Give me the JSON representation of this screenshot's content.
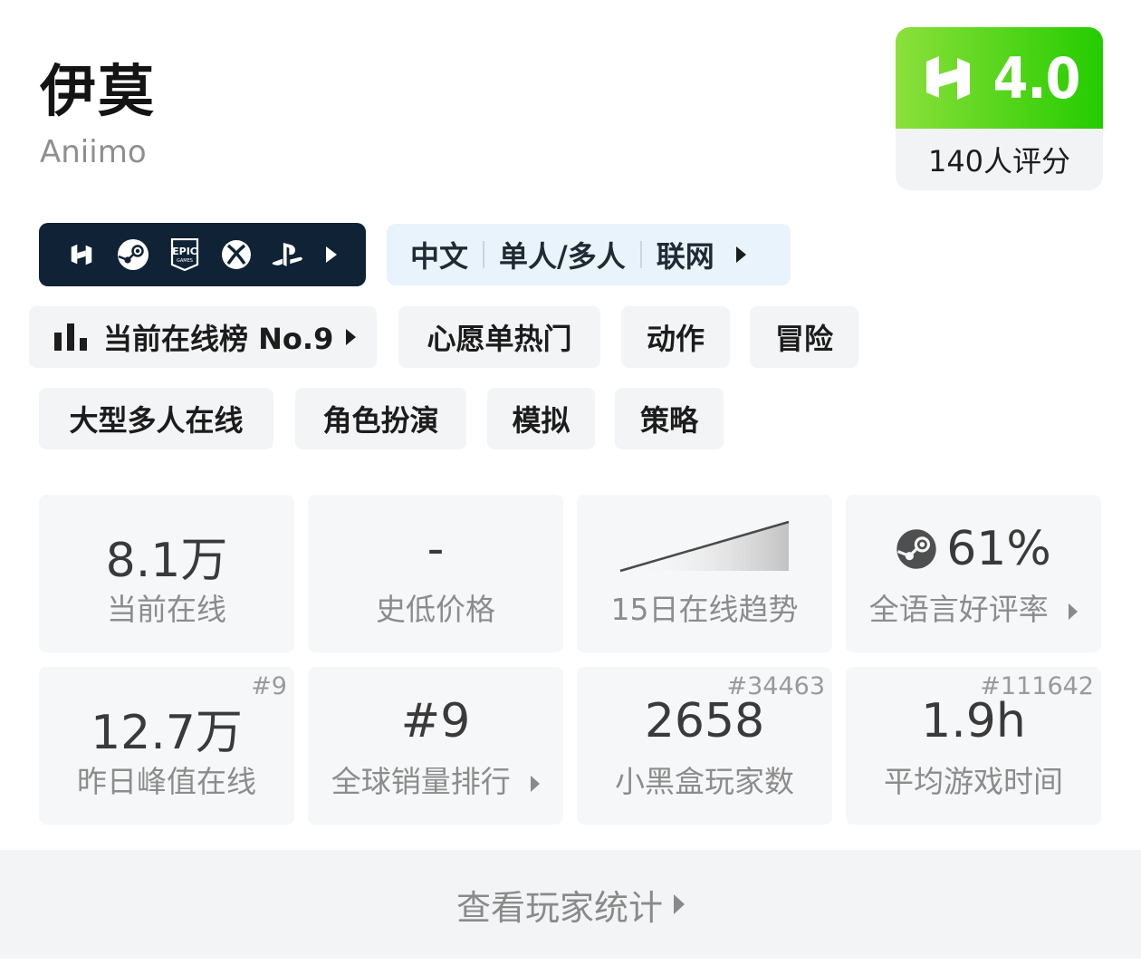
{
  "game": {
    "title": "伊莫",
    "subtitle": "Aniimo"
  },
  "score": {
    "value": "4.0",
    "count_label": "140人评分"
  },
  "platforms": {
    "icons": [
      "heybox-icon",
      "steam-icon",
      "epic-games-icon",
      "xbox-icon",
      "playstation-icon"
    ]
  },
  "features": {
    "items": [
      "中文",
      "单人/多人",
      "联网"
    ]
  },
  "tags": {
    "ranking": "当前在线榜 No.9",
    "wishlist": "心愿单热门",
    "items": [
      "动作",
      "冒险",
      "大型多人在线",
      "角色扮演",
      "模拟",
      "策略"
    ]
  },
  "stats": {
    "current_online": {
      "value": "8.1万",
      "label": "当前在线"
    },
    "lowest_price": {
      "value": "-",
      "label": "史低价格"
    },
    "trend": {
      "label": "15日在线趋势"
    },
    "rating": {
      "value": "61%",
      "label": "全语言好评率"
    },
    "peak": {
      "value": "12.7万",
      "label": "昨日峰值在线",
      "rank": "#9"
    },
    "sales_rank": {
      "value": "#9",
      "label": "全球销量排行"
    },
    "players": {
      "value": "2658",
      "label": "小黑盒玩家数",
      "rank": "#34463"
    },
    "playtime": {
      "value": "1.9h",
      "label": "平均游戏时间",
      "rank": "#111642"
    }
  },
  "footer": {
    "label": "查看玩家统计"
  },
  "colors": {
    "score_green": "#24cc00",
    "platform_bg": "#0f2236",
    "feature_bg": "#e8f3fb"
  }
}
